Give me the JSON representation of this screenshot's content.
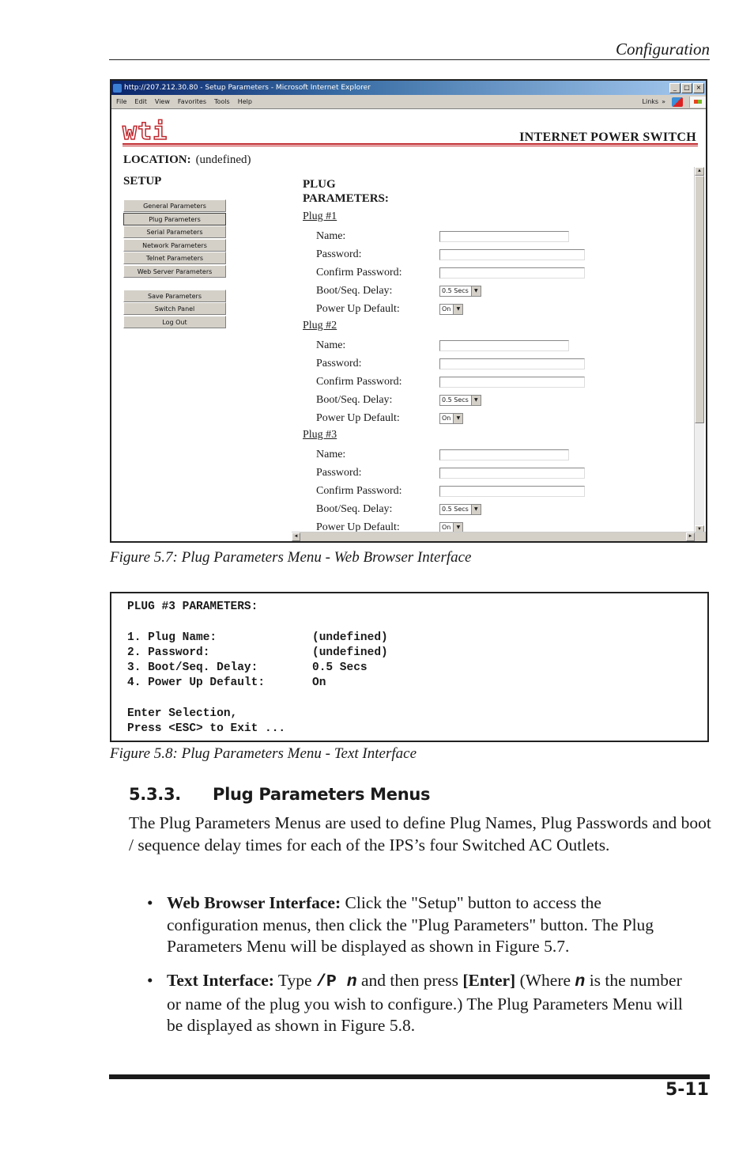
{
  "page": {
    "running_head": "Configuration",
    "page_number": "5-11"
  },
  "browser": {
    "title": "http://207.212.30.80 - Setup Parameters - Microsoft Internet Explorer",
    "window_buttons": [
      "_",
      "□",
      "×"
    ],
    "menu": [
      "File",
      "Edit",
      "View",
      "Favorites",
      "Tools",
      "Help"
    ],
    "links_label": "Links",
    "chevron": "»",
    "logo_text": "wti",
    "brand": "INTERNET POWER SWITCH",
    "location_label": "LOCATION:",
    "location_value": "(undefined)",
    "setup_title": "SETUP",
    "nav_buttons": [
      {
        "label": "General Parameters",
        "active": false
      },
      {
        "label": "Plug Parameters",
        "active": true
      },
      {
        "label": "Serial Parameters",
        "active": false
      },
      {
        "label": "Network Parameters",
        "active": false
      },
      {
        "label": "Telnet Parameters",
        "active": false
      },
      {
        "label": "Web Server Parameters",
        "active": false
      }
    ],
    "action_buttons": [
      "Save Parameters",
      "Switch Panel",
      "Log Out"
    ],
    "panel_title_line1": "PLUG",
    "panel_title_line2": "PARAMETERS:",
    "field_labels": {
      "name": "Name:",
      "password": "Password:",
      "confirm": "Confirm Password:",
      "delay": "Boot/Seq. Delay:",
      "default": "Power Up Default:"
    },
    "plugs": [
      {
        "link": "Plug #1",
        "name": "",
        "password": "",
        "confirm": "",
        "delay": "0.5 Secs",
        "default": "On"
      },
      {
        "link": "Plug #2",
        "name": "",
        "password": "",
        "confirm": "",
        "delay": "0.5 Secs",
        "default": "On"
      },
      {
        "link": "Plug #3",
        "name": "",
        "password": "",
        "confirm": "",
        "delay": "0.5 Secs",
        "default": "On"
      }
    ],
    "scroll_up": "▲",
    "scroll_down": "▼",
    "scroll_left": "◄",
    "scroll_right": "►"
  },
  "figure_5_7_caption": "Figure 5.7:  Plug Parameters Menu - Web Browser Interface",
  "terminal": {
    "header": "PLUG #3 PARAMETERS:",
    "items": [
      {
        "key": "1. Plug Name:",
        "value": "(undefined)"
      },
      {
        "key": "2. Password:",
        "value": "(undefined)"
      },
      {
        "key": "3. Boot/Seq. Delay:",
        "value": "0.5 Secs"
      },
      {
        "key": "4. Power Up Default:",
        "value": "On"
      }
    ],
    "prompt1": "Enter Selection,",
    "prompt2": "Press <ESC> to Exit ..."
  },
  "figure_5_8_caption": "Figure 5.8:  Plug Parameters Menu - Text Interface",
  "section": {
    "number": "5.3.3.",
    "title": "Plug Parameters Menus",
    "intro": "The Plug Parameters Menus are used to define Plug Names, Plug Passwords and boot / sequence delay times for each of the IPS’s four Switched AC Outlets.",
    "bullet1": {
      "lead": "Web Browser Interface:",
      "text": "  Click the \"Setup\" button to access the configuration menus, then click the \"Plug Parameters\" button.  The Plug Parameters Menu will be displayed as shown in Figure 5.7."
    },
    "bullet2": {
      "lead": "Text Interface:",
      "t1": "  Type ",
      "cmd": "/P ",
      "var": "n",
      "t2": " and then press ",
      "key": "[Enter]",
      "t3": " (Where ",
      "var2": "n",
      "t4": " is the number or name of the plug you wish to configure.)  The Plug Parameters Menu will be displayed as shown in Figure 5.8."
    }
  }
}
